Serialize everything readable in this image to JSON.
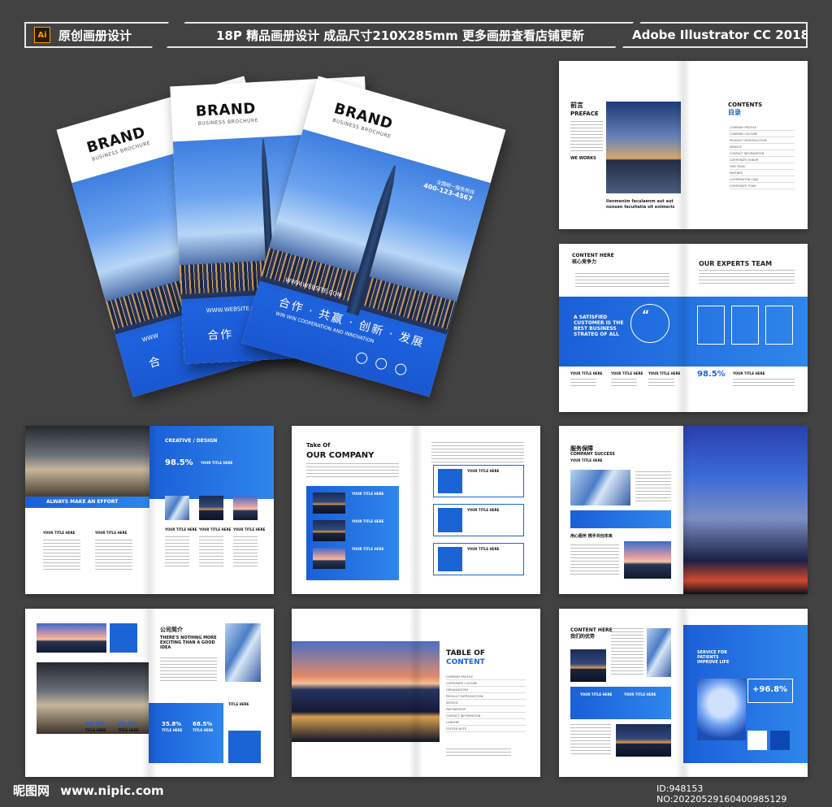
{
  "banner": {
    "left_badge": "Ai",
    "left_label": "原创画册设计",
    "middle_label": "18P 精品画册设计 成品尺寸210X285mm 更多画册查看店铺更新",
    "right_label": "Adobe Illustrator CC 2018"
  },
  "cover": {
    "brand": "BRAND",
    "brand_sub": "BUSINESS BROCHURE",
    "website": "WWW.WEBSITE.COM",
    "slogan": "合作 · 共赢 · 创新 · 发展",
    "slogan_en": "WIN WIN COOPERATION AND INNOVATION",
    "hotline_label": "全国统一服务热线",
    "hotline": "400-123-4567",
    "partial_a": "合",
    "partial_b": "WWW",
    "partial_c": "合作"
  },
  "spread1": {
    "preface_cn": "前言",
    "preface_en": "PREFACE",
    "we_works": "WE WORKS",
    "caption": "Ilenmenim faculaenm aut aut nonsen facultatia sit enimeris",
    "contents_en": "CONTENTS",
    "contents_cn": "目录",
    "toc": [
      "COMPANY PROFILE",
      "COMPANY CULTURE",
      "PRODUCT INTRODUCTION",
      "SERVICE",
      "CONTACT INFORMATION",
      "CORPORATE HONOR",
      "OUR TEAM",
      "PARTNER",
      "COOPERATION CASE",
      "CORPORATE TEAM"
    ]
  },
  "spread2": {
    "content_here": "CONTENT HERE",
    "core_cn": "核心竞争力",
    "experts": "OUR EXPERTS TEAM",
    "your_title_here": "YOUR TITLE HERE",
    "quote": "A SATISFIED CUSTOMER IS THE BEST BUSINESS STRATEG OF ALL",
    "percent": "98.5%",
    "quote_mark": "“"
  },
  "spread3": {
    "creative": "CREATIVE / DESIGN",
    "percent": "98.5%",
    "your_title_here": "YOUR TITLE HERE",
    "always": "ALWAYS MAKE AN EFFORT"
  },
  "spread4": {
    "take_of": "Take Of",
    "our_company": "OUR COMPANY",
    "your_title_here": "YOUR TITLE HERE"
  },
  "spread5": {
    "service_cn": "服务保障",
    "company_success": "COMPANY SUCCESS",
    "your_title_here": "YOUR TITLE HERE",
    "caption_cn": "用心服务 携手共创未来"
  },
  "spread6": {
    "intro_cn": "公司简介",
    "headline": "THERE'S NOTHING MORE EXCITING THAN A GOOD IDEA",
    "stat1": "98.5%",
    "stat2": "45.5%",
    "stat3": "35.8%",
    "stat4": "68.5%",
    "title_here": "TITLE HERE"
  },
  "spread7": {
    "title_line1": "TABLE OF",
    "title_line2": "CONTENT",
    "toc": [
      "COMPANY PROFILE",
      "CORPORATE CULTURE",
      "ORGANIZATION",
      "PRODUCT INTRODUCTION",
      "SERVICE",
      "PARTNERSHIP",
      "CONTACT INFORMATION",
      "CAREERS",
      "FOOTER NOTE"
    ]
  },
  "spread8": {
    "content_here": "CONTENT HERE",
    "adv_cn": "我们的优势",
    "service": "SERVICE FOR PATIENTS IMPROVE LIFE",
    "percent": "+96.8%",
    "your_title_here": "YOUR TITLE HERE"
  },
  "footer": {
    "logo_cn": "昵图网",
    "url": "www.nipic.com",
    "id": "ID:948153 NO:20220529160400985129"
  },
  "colors": {
    "accent": "#1a64d6",
    "background": "#424242"
  }
}
